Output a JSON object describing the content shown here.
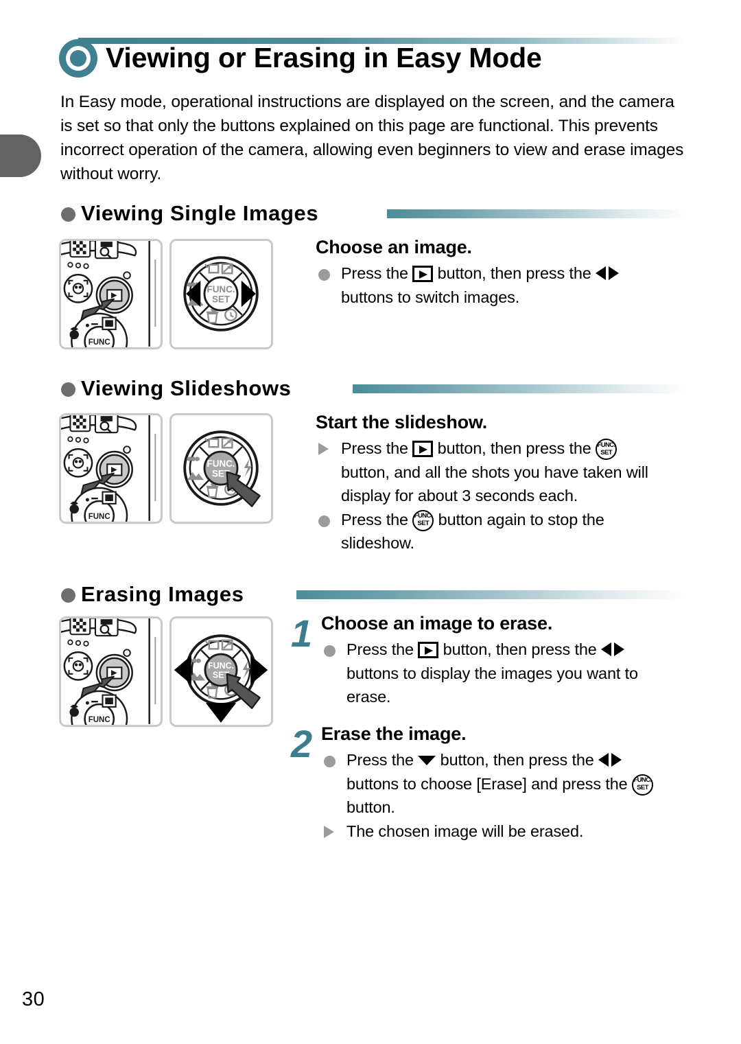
{
  "page": {
    "number": "30",
    "title": "Viewing or Erasing in Easy Mode",
    "title_icon": "easy-mode-ring-icon",
    "intro": "In Easy mode, operational instructions are displayed on the screen, and the camera is set so that only the buttons explained on this page are functional. This prevents incorrect operation of the camera, allowing even beginners to view and erase images without worry.",
    "accent_teal": "#3f8190",
    "step_number_color": "#3d7d8c",
    "bullet_gray": "#9b9b9b"
  },
  "sections": [
    {
      "id": "viewing-single-images",
      "heading": "Viewing Single Images",
      "instruction_heading": "Choose an image.",
      "lines": [
        {
          "marker": "dot",
          "parts": [
            {
              "t": "text",
              "v": "Press the "
            },
            {
              "t": "icon",
              "v": "playback-icon"
            },
            {
              "t": "text",
              "v": " button, then press the "
            },
            {
              "t": "icon",
              "v": "left-right-arrows-icon"
            }
          ],
          "plain": "Press the [playback] button, then press the [left/right] buttons to switch images.",
          "continuation": "buttons to switch images."
        }
      ],
      "diagram": {
        "camera_back": "camera-back-playback-button-highlighted",
        "controller": "four-way-controller-left-right-highlighted",
        "controller_center_label_top": "FUNC.",
        "controller_center_label_bottom": "SET"
      }
    },
    {
      "id": "viewing-slideshows",
      "heading": "Viewing Slideshows",
      "instruction_heading": "Start the slideshow.",
      "lines": [
        {
          "marker": "triangle",
          "plain": "Press the [playback] button, then press the [FUNC./SET] button, and all the shots you have taken will display for about 3 seconds each.",
          "continuation_1": "button, and all the shots you have taken will",
          "continuation_2": "display for about 3 seconds each."
        },
        {
          "marker": "dot",
          "plain": "Press the [FUNC./SET] button again to stop the slideshow.",
          "continuation_1": "slideshow."
        }
      ],
      "diagram": {
        "camera_back": "camera-back-playback-button-highlighted",
        "controller": "four-way-controller-func-set-highlighted",
        "controller_center_label_top": "FUNC.",
        "controller_center_label_bottom": "SET"
      }
    },
    {
      "id": "erasing-images",
      "heading": "Erasing Images",
      "steps": [
        {
          "number": "1",
          "instruction_heading": "Choose an image to erase.",
          "lines": [
            {
              "marker": "dot",
              "plain": "Press the [playback] button, then press the [left/right] buttons to display the images you want to erase.",
              "continuation_1": "buttons to display the images you want to",
              "continuation_2": "erase."
            }
          ]
        },
        {
          "number": "2",
          "instruction_heading": "Erase the image.",
          "lines": [
            {
              "marker": "dot",
              "plain": "Press the [down] button, then press the [left/right] buttons to choose [Erase] and press the [FUNC./SET] button.",
              "continuation_1": "buttons to choose [Erase] and press the ",
              "continuation_2": "button."
            },
            {
              "marker": "triangle",
              "plain": "The chosen image will be erased."
            }
          ]
        }
      ],
      "diagram": {
        "camera_back": "camera-back-playback-button-highlighted",
        "controller": "four-way-controller-all-directions-and-func-set-highlighted",
        "controller_center_label_top": "FUNC.",
        "controller_center_label_bottom": "SET"
      }
    }
  ],
  "text_fragments": {
    "press_the": "Press the ",
    "button_then_press_the": " button, then press the ",
    "button_word": " button",
    "switch_images_cont": "buttons to switch images.",
    "slideshow_cont1": "button, and all the shots you have taken will",
    "slideshow_cont2": "display for about 3 seconds each.",
    "slideshow_stop_a": " button again to stop the",
    "slideshow_stop_b": "slideshow.",
    "erase_cont1": "buttons to display the images you want to",
    "erase_cont2": "erase.",
    "erase2_cont1": "buttons to choose [Erase] and press the ",
    "erase2_cont2": "button.",
    "erased_result": "The chosen image will be erased."
  },
  "controller_icons": {
    "top_left": "display-icon",
    "top_right": "exposure-compensation-icon",
    "left_upper": "macro-icon",
    "left_lower": "landscape-icon",
    "right": "flash-icon",
    "bottom_left": "erase-icon",
    "bottom_right": "self-timer-icon",
    "center_top": "FUNC.",
    "center_bottom": "SET"
  }
}
